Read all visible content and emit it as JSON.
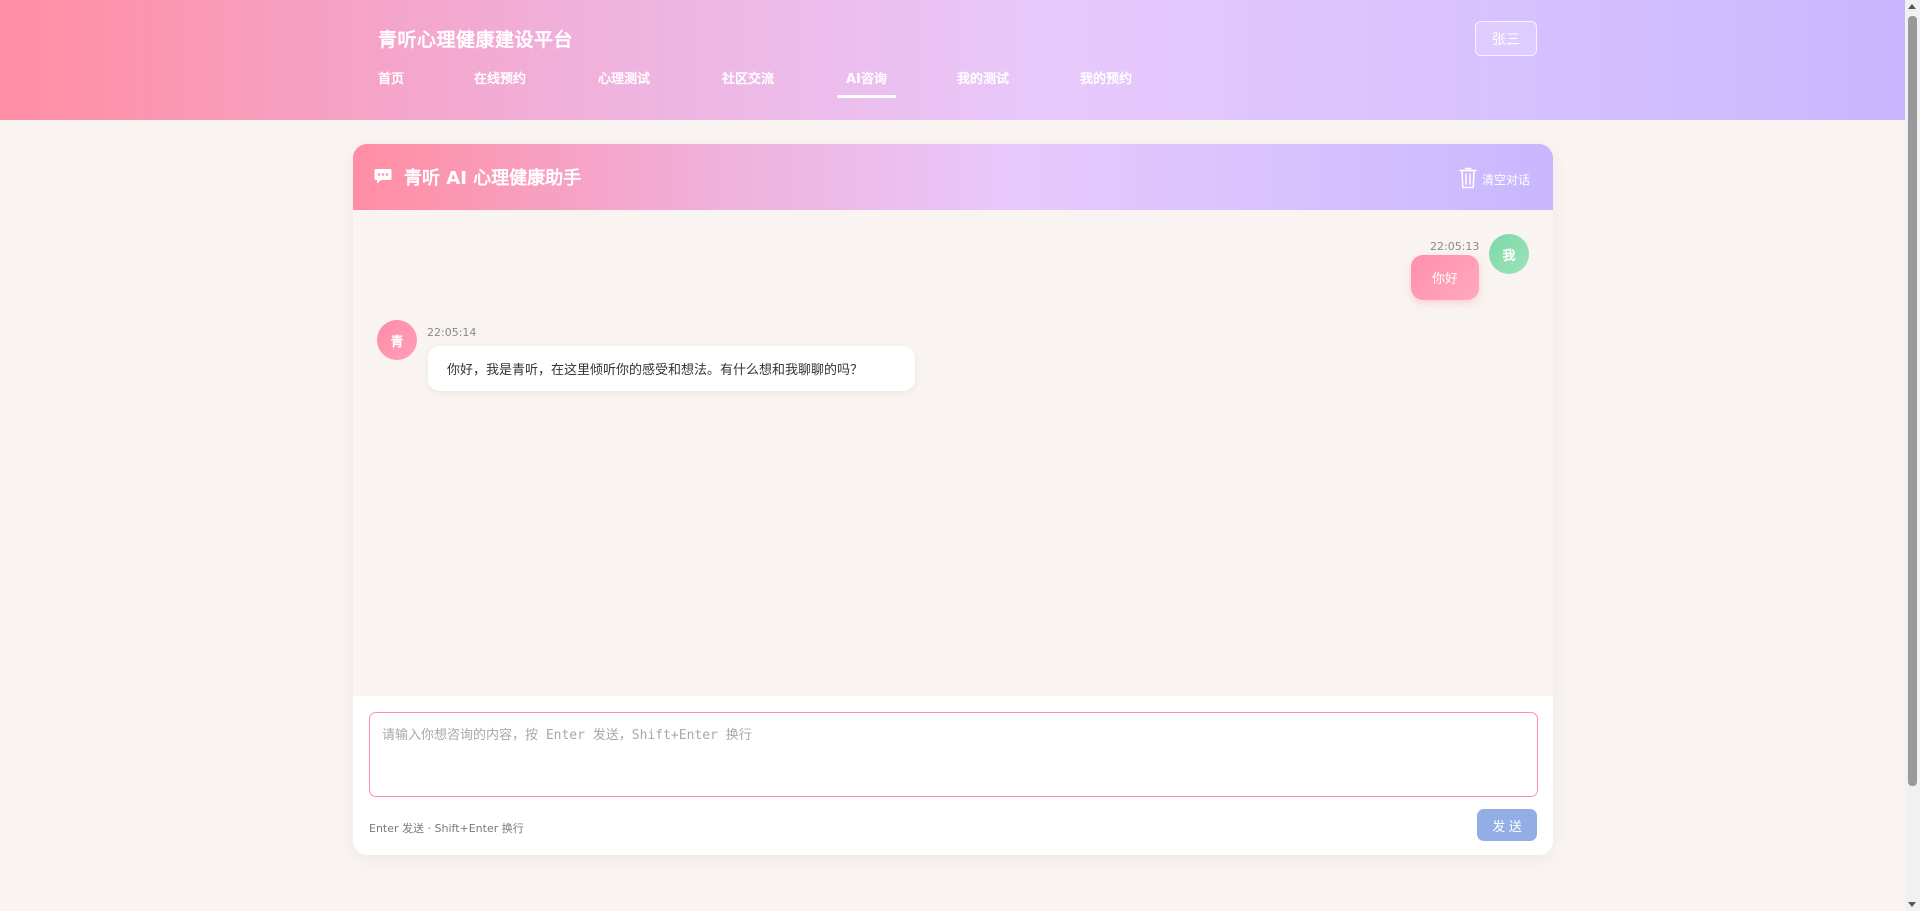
{
  "header": {
    "brand": "青听心理健康建设平台",
    "nav": [
      {
        "label": "首页"
      },
      {
        "label": "在线预约"
      },
      {
        "label": "心理测试"
      },
      {
        "label": "社区交流"
      },
      {
        "label": "AI咨询",
        "active": true
      },
      {
        "label": "我的测试"
      },
      {
        "label": "我的预约"
      }
    ],
    "user": "张三"
  },
  "chat": {
    "title": "青听 AI 心理健康助手",
    "title_icon": "chat-bubble-icon",
    "clear_label": "清空对话",
    "clear_icon": "trash-icon",
    "messages": [
      {
        "role": "user",
        "avatar": "我",
        "time": "22:05:13",
        "text": "你好"
      },
      {
        "role": "assistant",
        "avatar": "青",
        "time": "22:05:14",
        "text": "你好，我是青听，在这里倾听你的感受和想法。有什么想和我聊聊的吗？"
      }
    ]
  },
  "composer": {
    "placeholder": "请输入你想咨询的内容，按 Enter 发送，Shift+Enter 换行",
    "value": "",
    "hint": "Enter 发送 · Shift+Enter 换行",
    "send_label": "发 送"
  },
  "colors": {
    "header_gradient_start": "#ff8da3",
    "header_gradient_end": "#c8b7fe",
    "page_background": "#f9f4f1",
    "user_bubble": "#ff9ab3",
    "user_avatar": "#8ddcb0",
    "ai_avatar": "#ff94ae",
    "input_border": "#ff8fb0",
    "send_button": "#93aee5"
  }
}
